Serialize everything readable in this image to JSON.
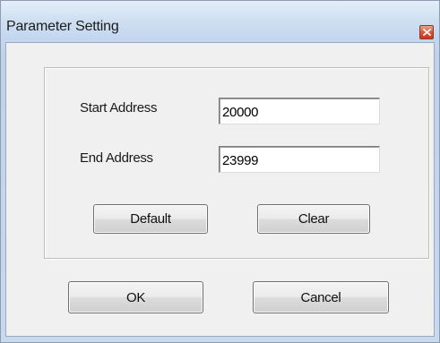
{
  "window": {
    "title": "Parameter Setting"
  },
  "fields": {
    "start_address": {
      "label": "Start Address",
      "value": "20000"
    },
    "end_address": {
      "label": "End Address",
      "value": "23999"
    }
  },
  "buttons": {
    "default_label": "Default",
    "clear_label": "Clear",
    "ok_label": "OK",
    "cancel_label": "Cancel"
  },
  "colors": {
    "titlebar": "#cfdff1",
    "client_bg": "#f0f0f0",
    "close_button": "#d9573a"
  },
  "icons": {
    "close": "close-icon"
  }
}
